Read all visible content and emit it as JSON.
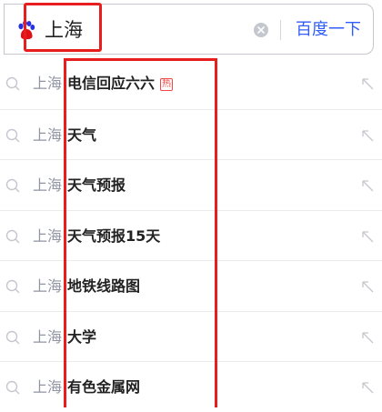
{
  "search": {
    "query": "上海",
    "submit_label": "百度一下"
  },
  "suggestions": [
    {
      "prefix": "上海",
      "suffix": "电信回应六六",
      "badge": "热"
    },
    {
      "prefix": "上海",
      "suffix": "天气",
      "badge": ""
    },
    {
      "prefix": "上海",
      "suffix": "天气预报",
      "badge": ""
    },
    {
      "prefix": "上海",
      "suffix": "天气预报15天",
      "badge": ""
    },
    {
      "prefix": "上海",
      "suffix": "地铁线路图",
      "badge": ""
    },
    {
      "prefix": "上海",
      "suffix": "大学",
      "badge": ""
    },
    {
      "prefix": "上海",
      "suffix": "有色金属网",
      "badge": ""
    }
  ],
  "icons": {
    "logo": "baidu-paw-icon",
    "clear": "clear-icon",
    "row_search": "search-icon",
    "row_fill": "fill-arrow-icon"
  },
  "colors": {
    "accent": "#315efb",
    "highlight": "#e81e1e",
    "hot_badge": "#f54545",
    "muted_text": "#9195a3"
  }
}
